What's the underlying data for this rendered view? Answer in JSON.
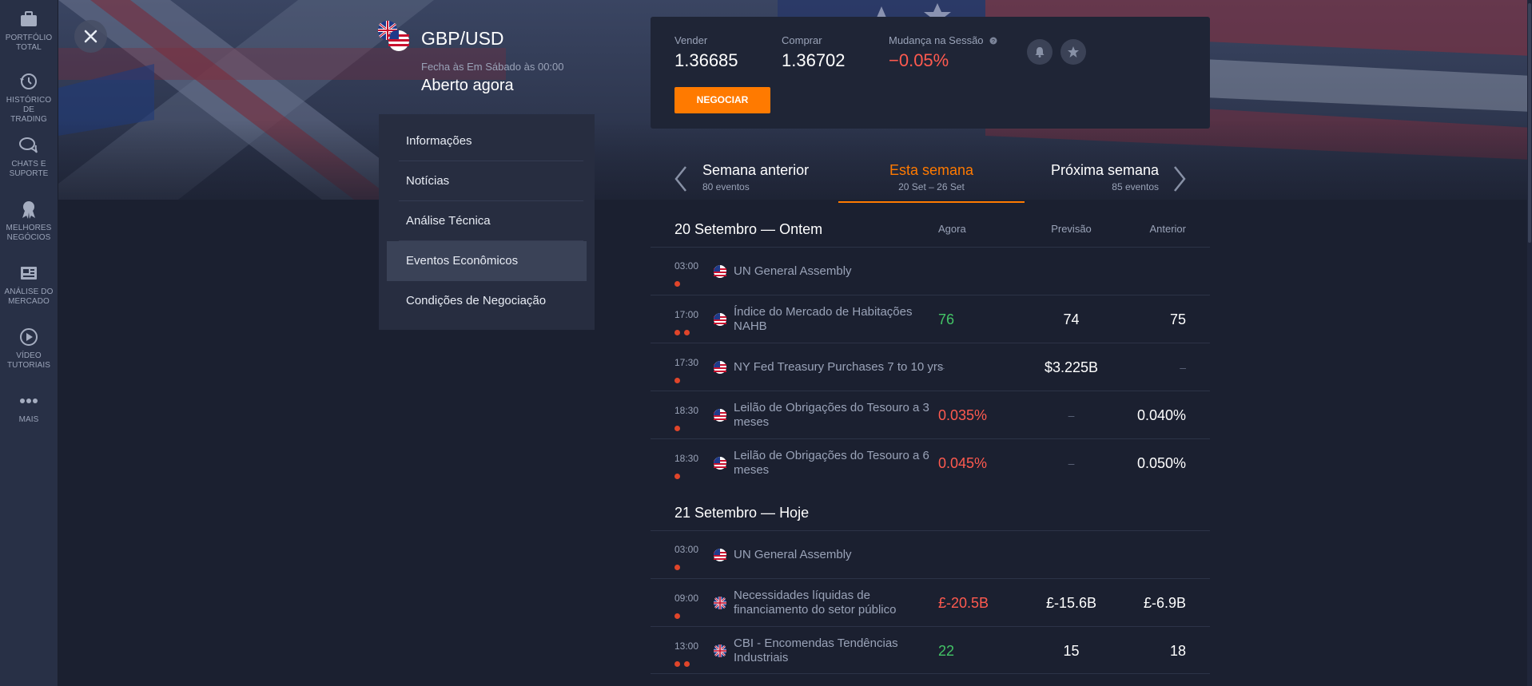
{
  "sidebar": {
    "items": [
      {
        "label_1": "PORTFÓLIO",
        "label_2": "TOTAL",
        "icon": "briefcase-icon"
      },
      {
        "label_1": "HISTÓRICO DE",
        "label_2": "TRADING",
        "icon": "history-icon"
      },
      {
        "label_1": "CHATS E",
        "label_2": "SUPORTE",
        "icon": "chat-icon"
      },
      {
        "label_1": "MELHORES",
        "label_2": "NEGÓCIOS",
        "icon": "medal-icon"
      },
      {
        "label_1": "ANÁLISE DO",
        "label_2": "MERCADO",
        "icon": "newspaper-icon"
      },
      {
        "label_1": "VÍDEO",
        "label_2": "TUTORIAIS",
        "icon": "play-icon"
      },
      {
        "label_1": "MAIS",
        "label_2": "",
        "icon": "more-dots-icon"
      }
    ]
  },
  "asset": {
    "title": "GBP/USD",
    "closes": "Fecha às Em Sábado às 00:00",
    "status": "Aberto agora"
  },
  "menu": {
    "items": [
      "Informações",
      "Notícias",
      "Análise Técnica",
      "Eventos Econômicos",
      "Condições de Negociação"
    ],
    "active": "Eventos Econômicos"
  },
  "quote": {
    "sell_label": "Vender",
    "sell_value": "1.36685",
    "buy_label": "Comprar",
    "buy_value": "1.36702",
    "change_label": "Mudança na Sessão",
    "change_value": "−0.05%",
    "trade_label": "NEGOCIAR",
    "accent": "#ff7a00"
  },
  "weeks": {
    "prev_title": "Semana anterior",
    "prev_sub": "80 eventos",
    "current_title": "Esta semana",
    "current_sub": "20 Set – 26 Set",
    "next_title": "Próxima semana",
    "next_sub": "85 eventos"
  },
  "columns": {
    "now": "Agora",
    "forecast": "Previsão",
    "previous": "Anterior"
  },
  "days": [
    {
      "title": "20 Setembro — Ontem",
      "events": [
        {
          "time": "03:00",
          "dots": 1,
          "flag": "us",
          "name": "UN General Assembly",
          "now": "",
          "forecast": "",
          "previous": "",
          "now_color": ""
        },
        {
          "time": "17:00",
          "dots": 2,
          "flag": "us",
          "name": "Índice do Mercado de Habitações NAHB",
          "now": "76",
          "forecast": "74",
          "previous": "75",
          "now_color": "green"
        },
        {
          "time": "17:30",
          "dots": 1,
          "flag": "us",
          "name": "NY Fed Treasury Purchases 7 to 10 yrs",
          "now": "–",
          "forecast": "$3.225B",
          "previous": "–",
          "now_color": "muted"
        },
        {
          "time": "18:30",
          "dots": 1,
          "flag": "us",
          "name": "Leilão de Obrigações do Tesouro a 3 meses",
          "now": "0.035%",
          "forecast": "–",
          "previous": "0.040%",
          "now_color": "red"
        },
        {
          "time": "18:30",
          "dots": 1,
          "flag": "us",
          "name": "Leilão de Obrigações do Tesouro a 6 meses",
          "now": "0.045%",
          "forecast": "–",
          "previous": "0.050%",
          "now_color": "red"
        }
      ]
    },
    {
      "title": "21 Setembro — Hoje",
      "events": [
        {
          "time": "03:00",
          "dots": 1,
          "flag": "us",
          "name": "UN General Assembly",
          "now": "",
          "forecast": "",
          "previous": "",
          "now_color": ""
        },
        {
          "time": "09:00",
          "dots": 1,
          "flag": "uk",
          "name": "Necessidades líquidas de financiamento do setor público",
          "now": "£-20.5B",
          "forecast": "£-15.6B",
          "previous": "£-6.9B",
          "now_color": "red"
        },
        {
          "time": "13:00",
          "dots": 2,
          "flag": "uk",
          "name": "CBI - Encomendas Tendências Industriais",
          "now": "22",
          "forecast": "15",
          "previous": "18",
          "now_color": "green"
        }
      ]
    }
  ]
}
